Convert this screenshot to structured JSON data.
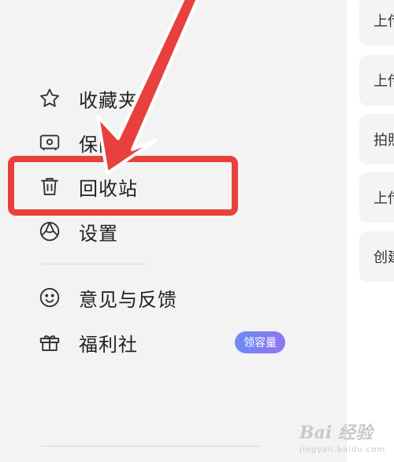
{
  "menu": {
    "items": [
      {
        "label": "收藏夹",
        "icon": "star-icon"
      },
      {
        "label": "保险箱",
        "icon": "safe-icon"
      },
      {
        "label": "回收站",
        "icon": "trash-icon"
      },
      {
        "label": "设置",
        "icon": "settings-icon"
      },
      {
        "label": "意见与反馈",
        "icon": "smile-icon"
      },
      {
        "label": "福利社",
        "icon": "gift-icon"
      }
    ],
    "badge": "领容量"
  },
  "content": {
    "cards": [
      "上传",
      "上传",
      "拍照",
      "上传",
      "创建"
    ]
  },
  "watermark": {
    "logo": "Bai 经验",
    "sub": "jingyan.baidu.com"
  },
  "colors": {
    "highlight": "#e8413d",
    "badge_start": "#6c8bf5",
    "badge_end": "#8f76f0"
  }
}
